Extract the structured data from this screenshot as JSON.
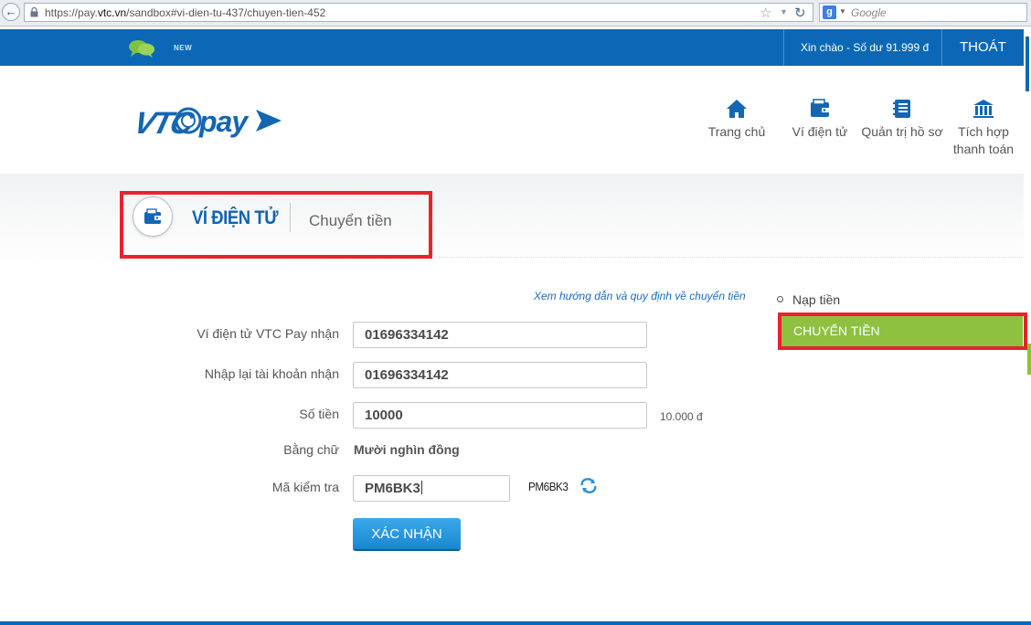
{
  "browser": {
    "url_prefix": "https://pay.",
    "url_domain": "vtc.vn",
    "url_path": "/sandbox#vi-dien-tu-437/chuyen-tien-452",
    "search_placeholder": "Google"
  },
  "topbar": {
    "new_badge": "NEW",
    "greeting": "Xin chào - Số dư 91.999 đ",
    "logout": "THOÁT"
  },
  "nav": [
    {
      "label": "Trang chủ",
      "icon": "home-icon"
    },
    {
      "label": "Ví điện tử",
      "icon": "wallet-icon"
    },
    {
      "label": "Quản trị hồ sơ",
      "icon": "notebook-icon"
    },
    {
      "label_line1": "Tích hợp",
      "label_line2": "thanh toán",
      "icon": "bank-icon"
    }
  ],
  "section": {
    "title": "VÍ ĐIỆN TỬ",
    "subtitle": "Chuyển tiền"
  },
  "form": {
    "guide_link": "Xem hướng dẫn và quy định về chuyển tiền",
    "fields": [
      {
        "label": "Ví điện tử VTC Pay nhận",
        "value": "01696334142"
      },
      {
        "label": "Nhập lại tài khoản nhận",
        "value": "01696334142"
      },
      {
        "label": "Số tiền",
        "value": "10000"
      }
    ],
    "amount_hint": "10.000 đ",
    "words_label": "Bằng chữ",
    "words_value": "Mười nghìn đồng",
    "captcha_label": "Mã kiểm tra",
    "captcha_value": "PM6BK3",
    "captcha_image_text": "PM6BK3",
    "submit_label": "XÁC NHẬN"
  },
  "sidebar": {
    "items": [
      {
        "label": "Nạp tiền",
        "active": false
      },
      {
        "label": "CHUYỂN TIỀN",
        "active": true
      }
    ]
  },
  "colors": {
    "brand_blue": "#0c68b6",
    "active_green": "#8dc13f",
    "highlight_red": "#e8232b",
    "button_blue": "#1a86d1"
  }
}
